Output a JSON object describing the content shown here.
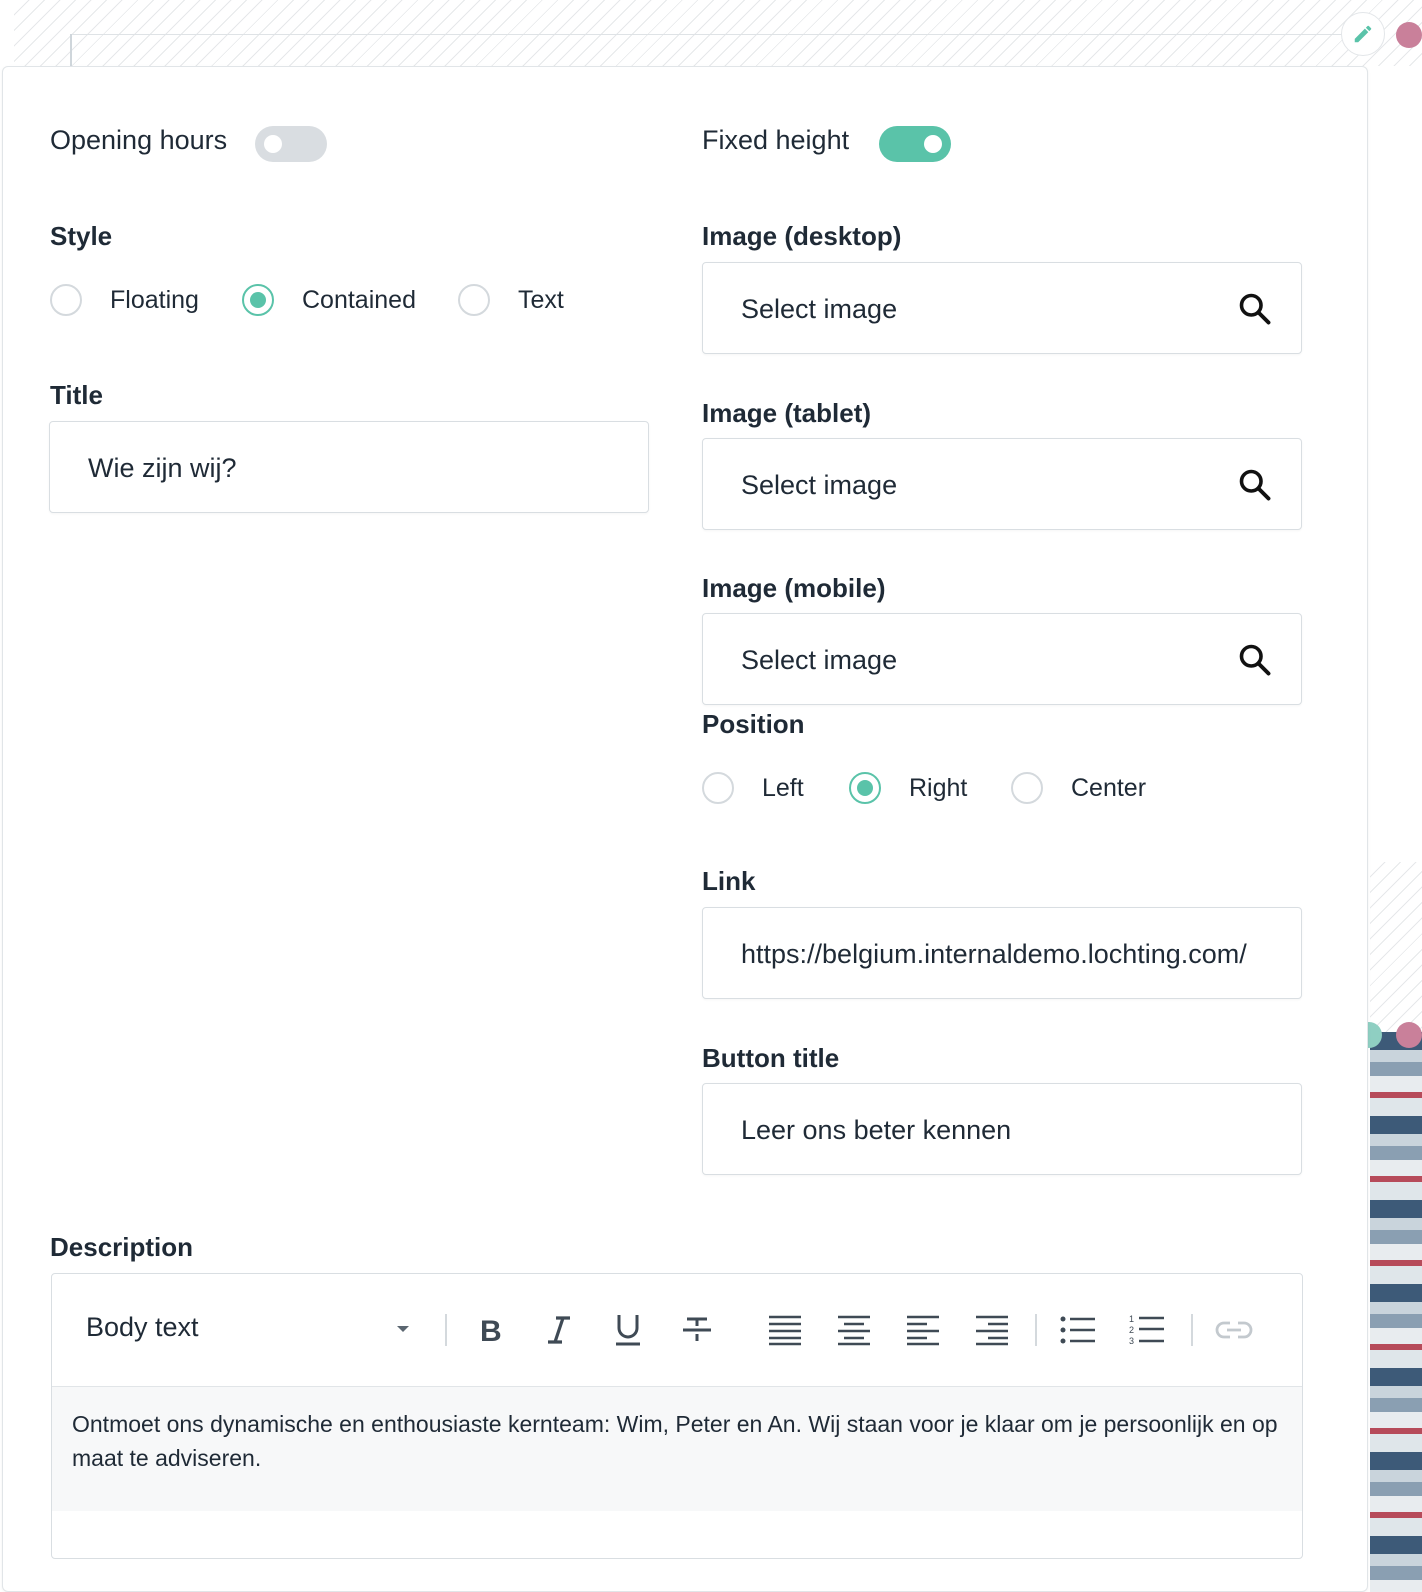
{
  "left": {
    "opening_hours_label": "Opening hours",
    "opening_hours_on": false,
    "style_label": "Style",
    "style_options": [
      "Floating",
      "Contained",
      "Text"
    ],
    "style_selected": "Contained",
    "title_label": "Title",
    "title_value": "Wie zijn wij?"
  },
  "right": {
    "fixed_height_label": "Fixed height",
    "fixed_height_on": true,
    "image_desktop_label": "Image (desktop)",
    "image_tablet_label": "Image (tablet)",
    "image_mobile_label": "Image (mobile)",
    "image_placeholder": "Select image",
    "position_label": "Position",
    "position_options": [
      "Left",
      "Right",
      "Center"
    ],
    "position_selected": "Right",
    "link_label": "Link",
    "link_value": "https://belgium.internaldemo.lochting.com/",
    "button_title_label": "Button title",
    "button_title_value": "Leer ons beter kennen"
  },
  "description": {
    "label": "Description",
    "format_value": "Body text",
    "toolbar_icons": [
      "bold-icon",
      "italic-icon",
      "underline-icon",
      "strikethrough-icon",
      "align-justify-icon",
      "align-center-icon",
      "align-left-icon",
      "align-right-icon",
      "bullet-list-icon",
      "numbered-list-icon",
      "link-icon"
    ],
    "text": "Ontmoet ons dynamische en enthousiaste kernteam: Wim, Peter en An. Wij staan voor je klaar om je persoonlijk en op maat te adviseren."
  },
  "colors": {
    "accent": "#5ac3a9",
    "toggle_off": "#d9dde1",
    "text": "#1f2a36",
    "border": "#d9dee2",
    "marker_pink": "#c9809a"
  }
}
